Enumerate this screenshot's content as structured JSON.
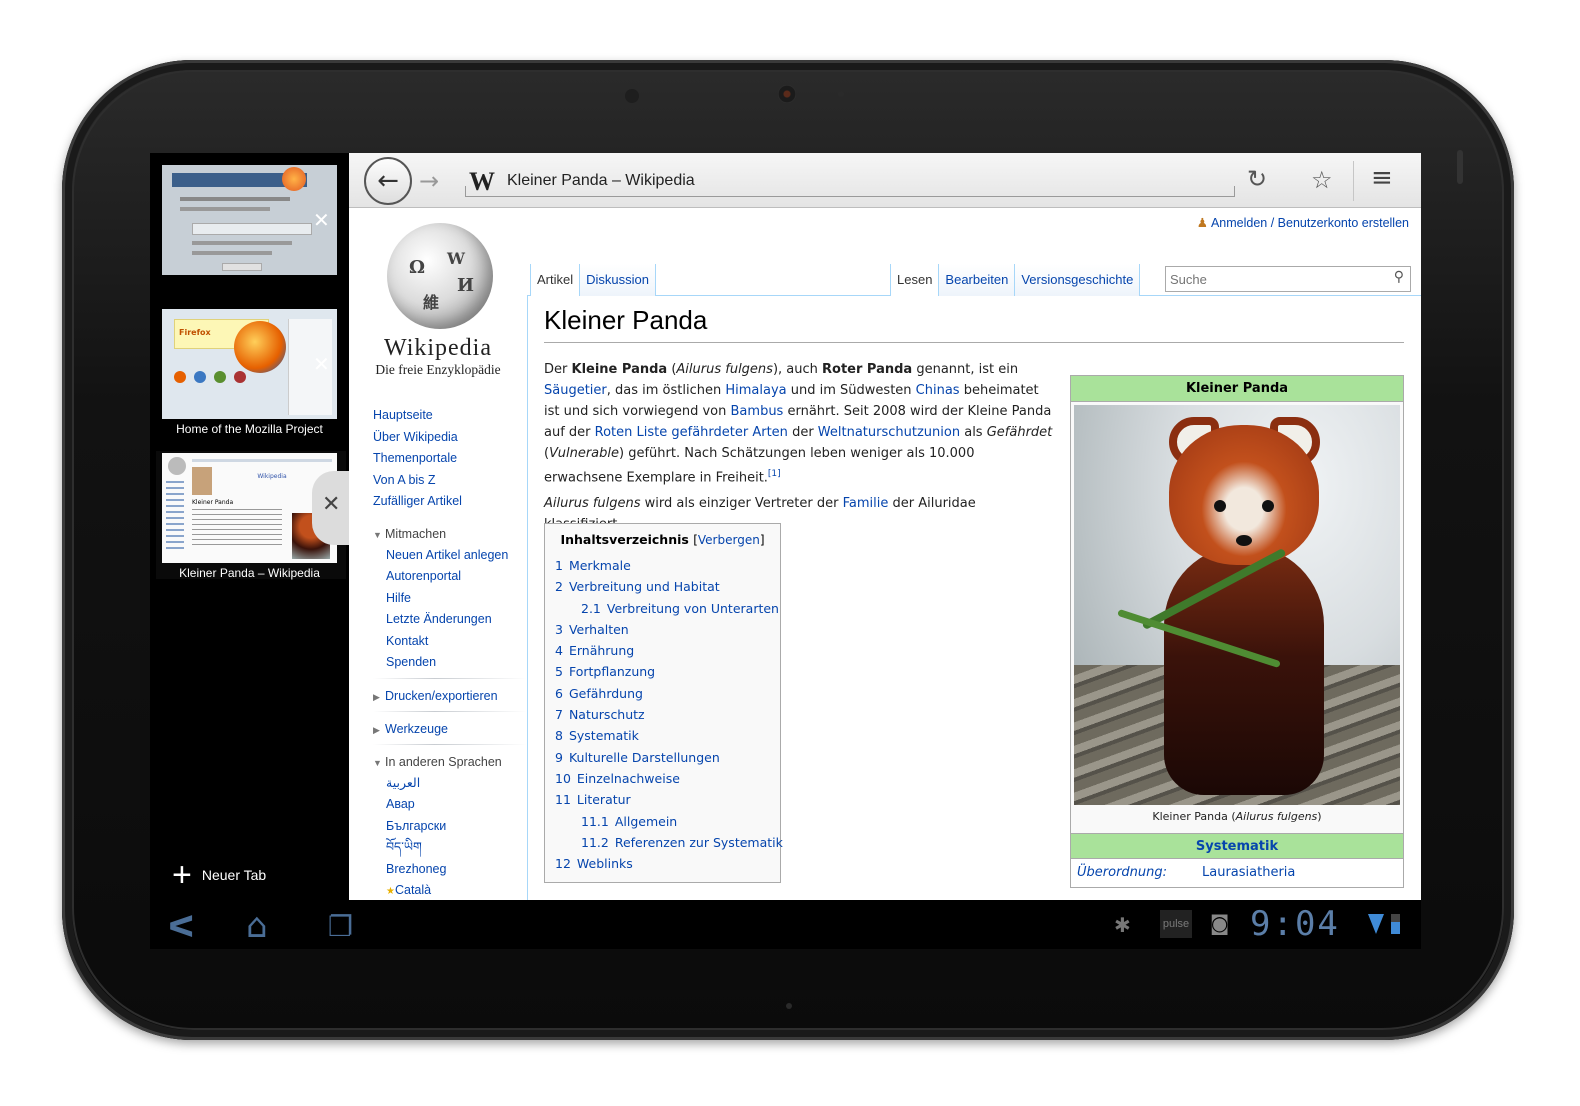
{
  "tabs": {
    "items": [
      {
        "label": ""
      },
      {
        "label": "Home of the Mozilla Project"
      },
      {
        "label": "Kleiner Panda – Wikipedia"
      }
    ],
    "new_tab_label": "Neuer Tab",
    "thumb_texts": {
      "mozilla_brand": "Firefox",
      "wiki_banner": "Wikipedia",
      "wiki_thumb_title": "Kleiner Panda"
    }
  },
  "toolbar": {
    "page_title": "Kleiner Panda – Wikipedia",
    "favicon_letter": "W"
  },
  "wiki": {
    "login": "Anmelden / Benutzerkonto erstellen",
    "logo_word": "Wikipedia",
    "tagline": "Die freie Enzyklopädie",
    "logo_glyphs": [
      "Ω",
      "W",
      "И",
      "維"
    ],
    "nav_main": [
      "Hauptseite",
      "Über Wikipedia",
      "Themenportale",
      "Von A bis Z",
      "Zufälliger Artikel"
    ],
    "portal_mitmachen": {
      "title": "Mitmachen",
      "items": [
        "Neuen Artikel anlegen",
        "Autorenportal",
        "Hilfe",
        "Letzte Änderungen",
        "Kontakt",
        "Spenden"
      ]
    },
    "portal_drucken": "Drucken/exportieren",
    "portal_werkzeuge": "Werkzeuge",
    "portal_sprachen": {
      "title": "In anderen Sprachen",
      "items": [
        "العربية",
        "Авар",
        "Български",
        "བོད་ཡིག",
        "Brezhoneg",
        "Català"
      ]
    },
    "tab_artikel": "Artikel",
    "tab_diskussion": "Diskussion",
    "tab_lesen": "Lesen",
    "tab_bearbeiten": "Bearbeiten",
    "tab_versionsgeschichte": "Versionsgeschichte",
    "search_placeholder": "Suche",
    "title": "Kleiner Panda",
    "lead": {
      "t1": "Der ",
      "b1": "Kleine Panda",
      "t2": " (",
      "i1": "Ailurus fulgens",
      "t3": "), auch ",
      "b2": "Roter Panda",
      "t4": " genannt, ist ein ",
      "l1": "Säugetier",
      "t5": ", das im östlichen ",
      "l2": "Himalaya",
      "t6": " und im Südwesten ",
      "l3": "Chinas",
      "t7": " beheimatet ist und sich vorwiegend von ",
      "l4": "Bambus",
      "t8": " ernährt. Seit 2008 wird der Kleine Panda auf der ",
      "l5": "Roten Liste gefährdeter Arten",
      "t9": " der ",
      "l6": "Weltnaturschutzunion",
      "t10": " als ",
      "i2": "Gefährdet",
      "t11": " (",
      "i3": "Vulnerable",
      "t12": ") geführt. Nach Schätzungen leben weniger als 10.000 erwachsene Exemplare in Freiheit.",
      "ref": "[1]"
    },
    "lead2": {
      "i1": "Ailurus fulgens",
      "t1": " wird als einziger Vertreter der ",
      "l1": "Familie",
      "t2": " der Ailuridae klassifiziert."
    },
    "toc": {
      "title": "Inhaltsverzeichnis",
      "hide": "Verbergen",
      "items": [
        {
          "num": "1",
          "label": "Merkmale",
          "sub": false
        },
        {
          "num": "2",
          "label": "Verbreitung und Habitat",
          "sub": false
        },
        {
          "num": "2.1",
          "label": "Verbreitung von Unterarten",
          "sub": true
        },
        {
          "num": "3",
          "label": "Verhalten",
          "sub": false
        },
        {
          "num": "4",
          "label": "Ernährung",
          "sub": false
        },
        {
          "num": "5",
          "label": "Fortpflanzung",
          "sub": false
        },
        {
          "num": "6",
          "label": "Gefährdung",
          "sub": false
        },
        {
          "num": "7",
          "label": "Naturschutz",
          "sub": false
        },
        {
          "num": "8",
          "label": "Systematik",
          "sub": false
        },
        {
          "num": "9",
          "label": "Kulturelle Darstellungen",
          "sub": false
        },
        {
          "num": "10",
          "label": "Einzelnachweise",
          "sub": false
        },
        {
          "num": "11",
          "label": "Literatur",
          "sub": false
        },
        {
          "num": "11.1",
          "label": "Allgemein",
          "sub": true
        },
        {
          "num": "11.2",
          "label": "Referenzen zur Systematik",
          "sub": true
        },
        {
          "num": "12",
          "label": "Weblinks",
          "sub": false
        }
      ]
    },
    "infobox": {
      "title": "Kleiner Panda",
      "caption_a": "Kleiner Panda (",
      "caption_i": "Ailurus fulgens",
      "caption_b": ")",
      "section": "Systematik",
      "row_key": "Überordnung:",
      "row_value": "Laurasiatheria"
    }
  },
  "system_bar": {
    "time": "9:04",
    "pulse_label": "pulse"
  },
  "colors": {
    "link": "#0645ad",
    "infobox_green": "#a9e29a",
    "system_blue": "#5b7ea8"
  }
}
